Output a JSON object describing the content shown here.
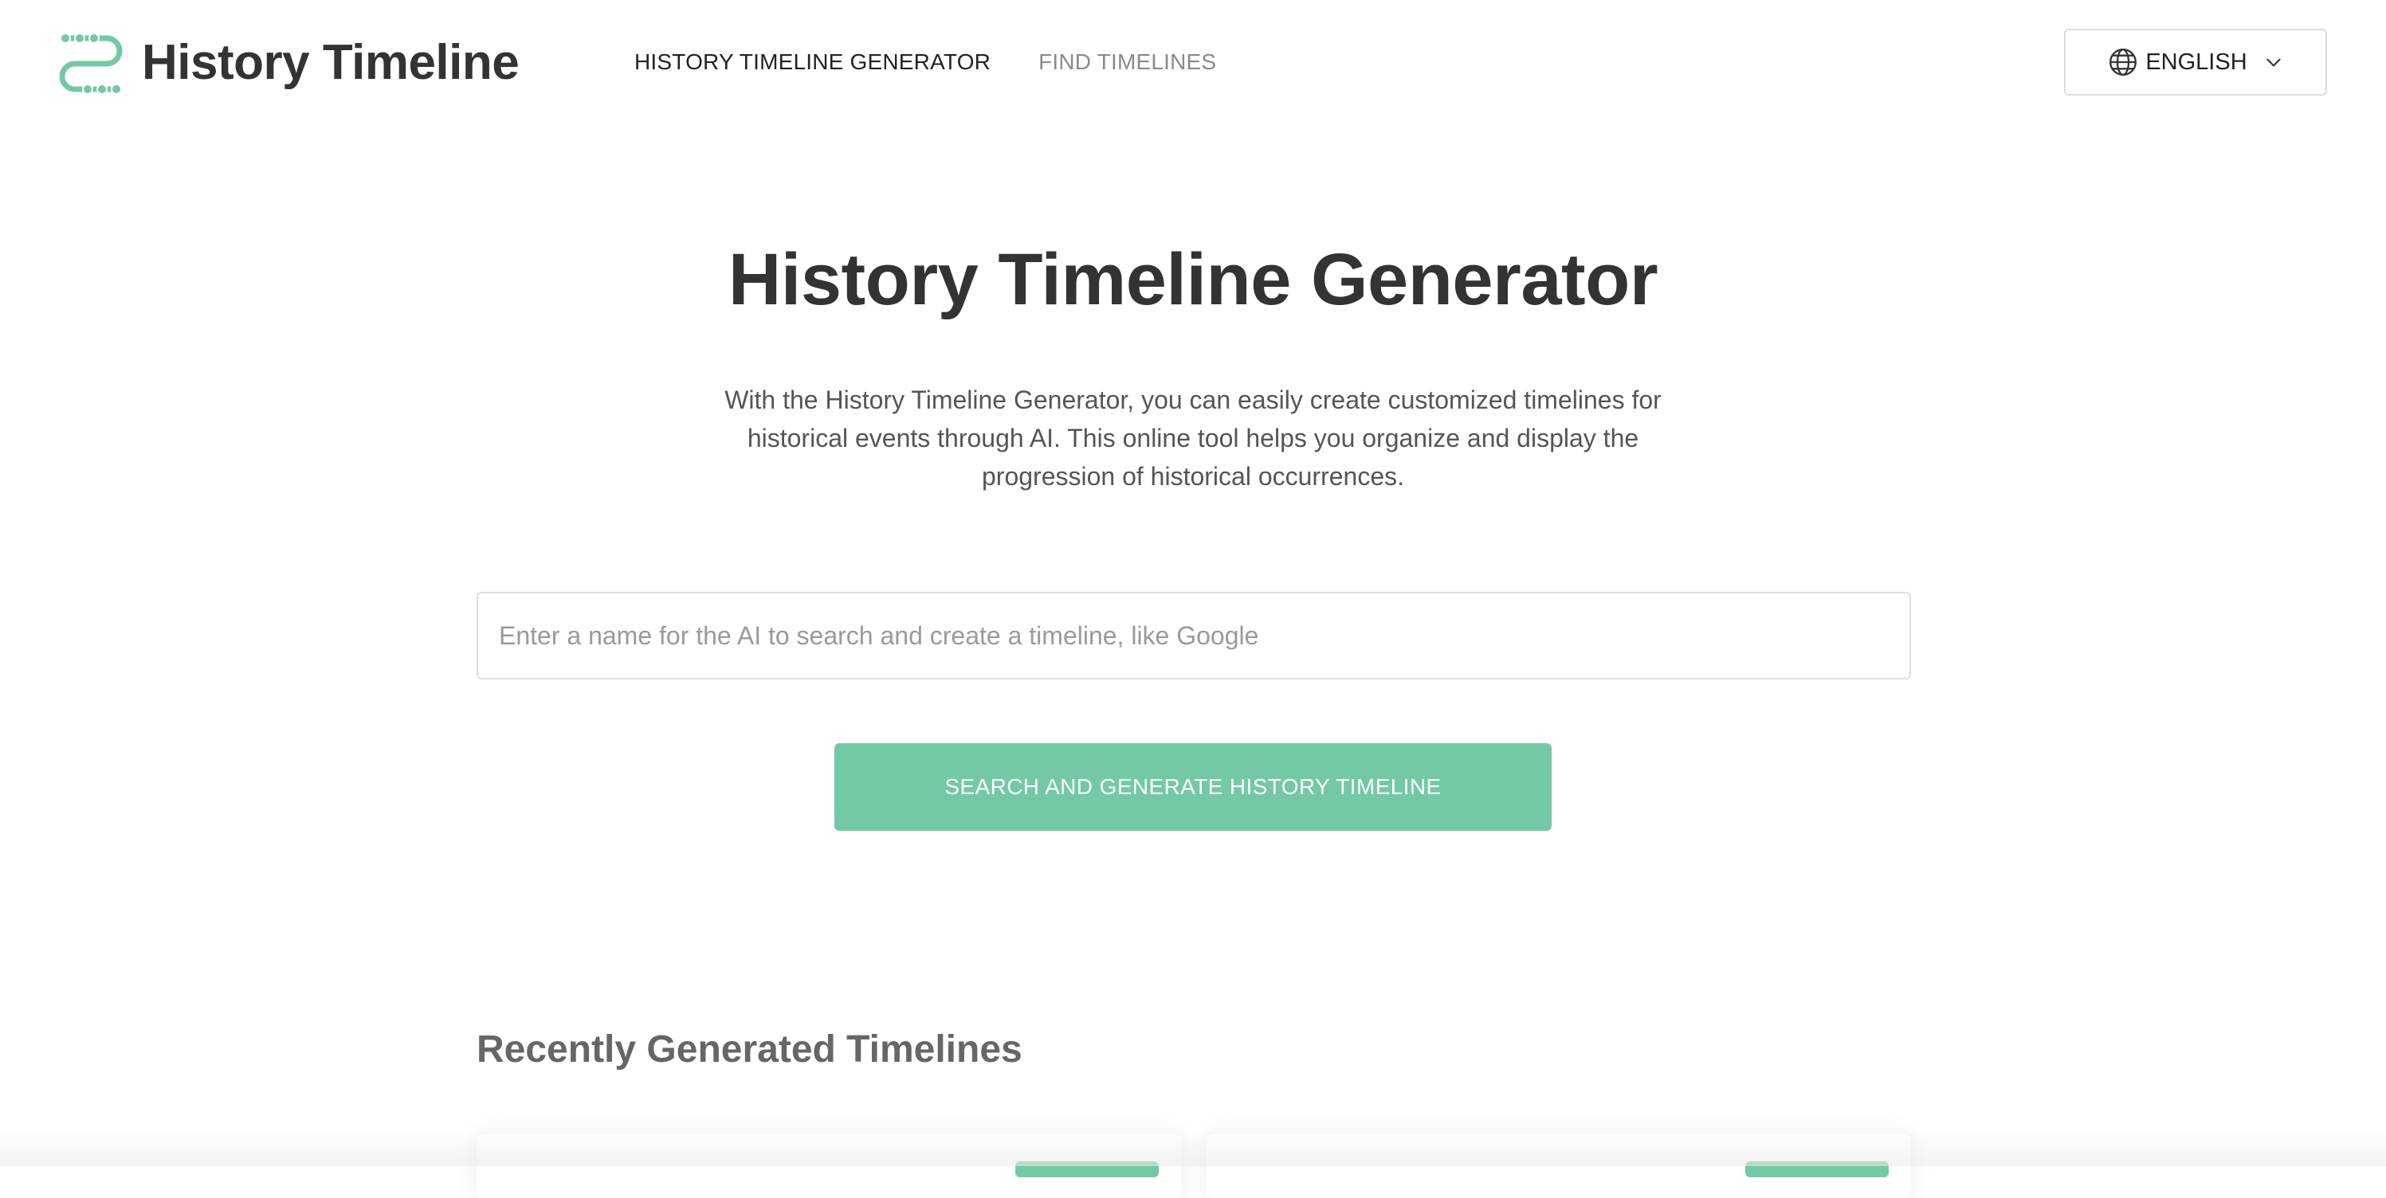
{
  "header": {
    "brand_name": "History Timeline",
    "logo_icon": "timeline-logo-icon",
    "nav": [
      {
        "label": "HISTORY TIMELINE GENERATOR",
        "active": true
      },
      {
        "label": "FIND TIMELINES",
        "active": false
      }
    ],
    "language": {
      "label": "ENGLISH",
      "icon": "globe-icon",
      "dropdown_icon": "chevron-down-icon"
    }
  },
  "hero": {
    "title": "History Timeline Generator",
    "description": "With the History Timeline Generator, you can easily create customized timelines for historical events through AI. This online tool helps you organize and display the progression of historical occurrences."
  },
  "search": {
    "value": "",
    "placeholder": "Enter a name for the AI to search and create a timeline, like Google",
    "button_label": "SEARCH AND GENERATE HISTORY TIMELINE"
  },
  "recent": {
    "heading": "Recently Generated Timelines"
  },
  "colors": {
    "accent": "#74c9a5",
    "text_primary": "#333333",
    "text_muted": "#8a8a8a"
  }
}
